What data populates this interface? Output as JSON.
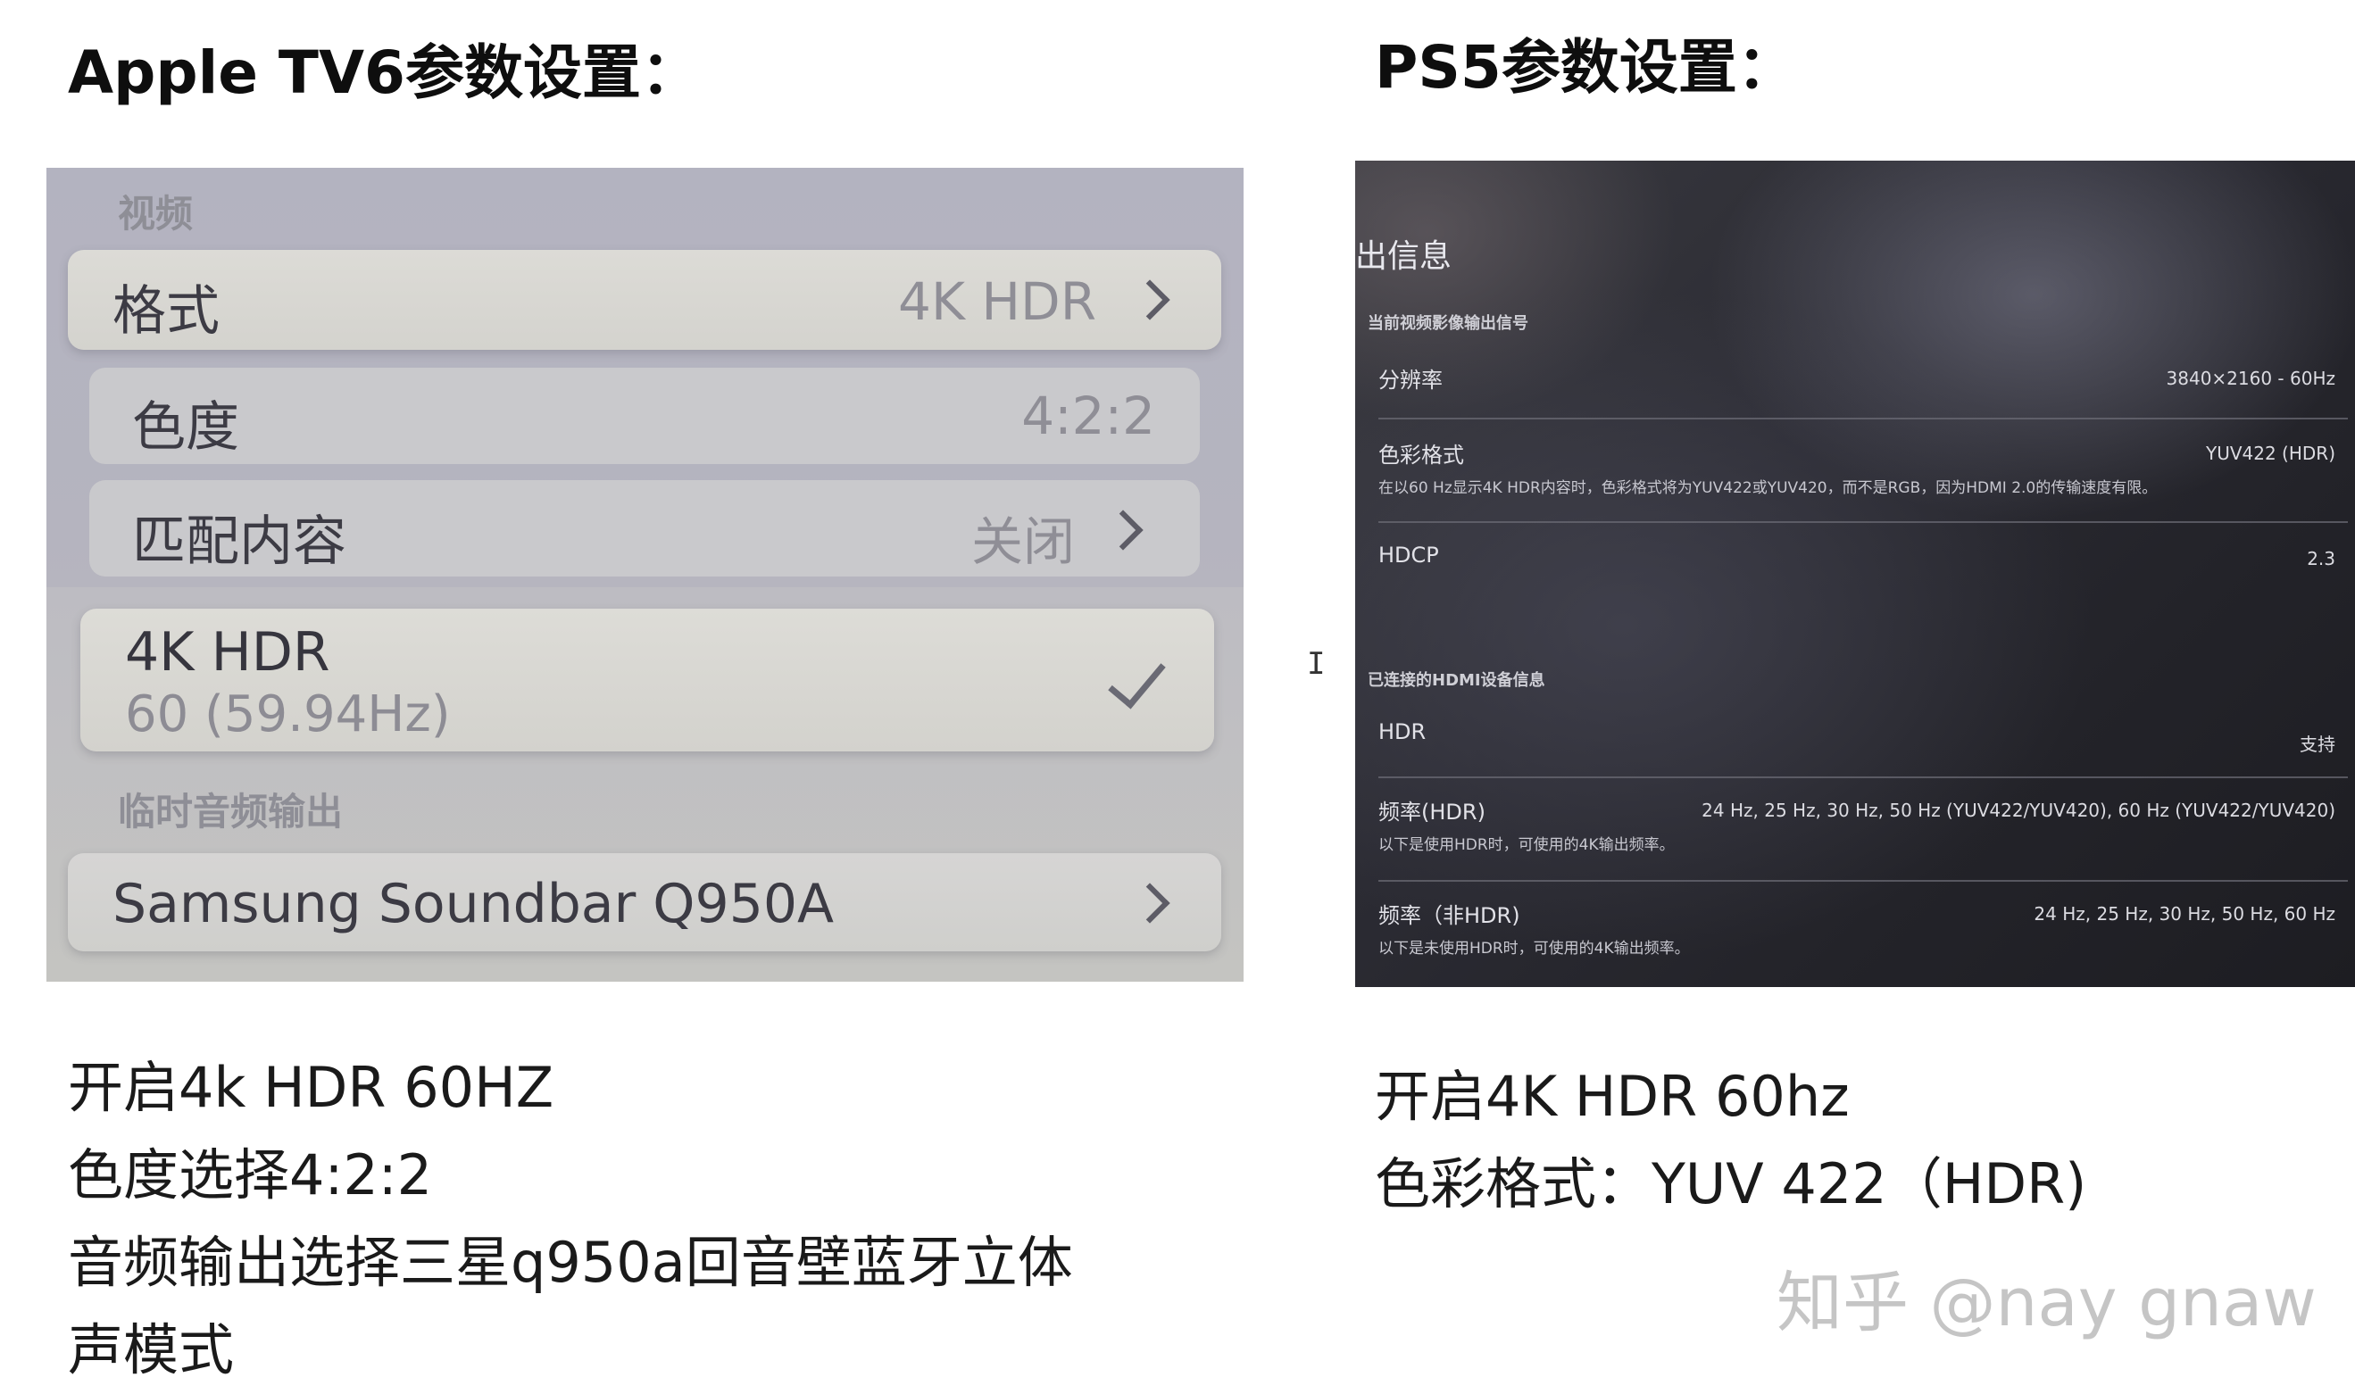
{
  "left": {
    "heading": "Apple TV6参数设置：",
    "screen": {
      "video_section": "视频",
      "format_label": "格式",
      "format_value": "4K HDR",
      "chroma_label": "色度",
      "chroma_value": "4:2:2",
      "match_label": "匹配内容",
      "match_value": "关闭",
      "selected_title": "4K HDR",
      "selected_sub": "60 (59.94Hz)",
      "audio_section": "临时音频输出",
      "audio_device": "Samsung Soundbar Q950A"
    },
    "caption": [
      "开启4k HDR 60HZ",
      "色度选择4:2:2",
      "音频输出选择三星q950a回音壁蓝牙立体",
      "声模式"
    ]
  },
  "right": {
    "heading": "PS5参数设置：",
    "screen": {
      "title": "出信息",
      "section1": "当前视频影像输出信号",
      "rows1": [
        {
          "key": "分辨率",
          "value": "3840×2160 - 60Hz",
          "desc": ""
        },
        {
          "key": "色彩格式",
          "value": "YUV422 (HDR)",
          "desc": "在以60 Hz显示4K HDR内容时，色彩格式将为YUV422或YUV420，而不是RGB，因为HDMI 2.0的传输速度有限。"
        },
        {
          "key": "HDCP",
          "value": "2.3",
          "desc": ""
        }
      ],
      "section2": "已连接的HDMI设备信息",
      "rows2": [
        {
          "key": "HDR",
          "value": "支持",
          "desc": ""
        },
        {
          "key": "频率(HDR)",
          "value": "24 Hz, 25 Hz, 30 Hz, 50 Hz (YUV422/YUV420), 60 Hz (YUV422/YUV420)",
          "desc": "以下是使用HDR时，可使用的4K输出频率。"
        },
        {
          "key": "频率（非HDR)",
          "value": "24 Hz, 25 Hz, 30 Hz, 50 Hz, 60 Hz",
          "desc": "以下是未使用HDR时，可使用的4K输出频率。"
        }
      ]
    },
    "caption": [
      "开启4K HDR 60hz",
      "色彩格式：YUV 422（HDR)"
    ]
  },
  "watermark": "知乎 @nay gnaw",
  "cursor_icon": "text-cursor-icon"
}
